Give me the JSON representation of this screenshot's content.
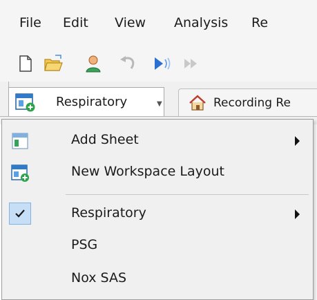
{
  "menubar": {
    "items": [
      "File",
      "Edit",
      "View",
      "Analysis",
      "Re"
    ]
  },
  "toolbar": {
    "icons": [
      "new-document-icon",
      "open-folder-icon",
      "user-icon",
      "undo-icon",
      "play-icon",
      "fast-forward-icon"
    ]
  },
  "tabs": {
    "workspace_label": "Respiratory",
    "recording_label": "Recording Re"
  },
  "menu": {
    "items": [
      {
        "label": "Add Sheet",
        "icon": "sheet-icon",
        "submenu": true
      },
      {
        "label": "New Workspace Layout",
        "icon": "new-layout-icon",
        "submenu": false
      },
      {
        "label": "Respiratory",
        "icon": "check-icon",
        "submenu": true,
        "checked": true
      },
      {
        "label": "PSG",
        "submenu": false
      },
      {
        "label": "Nox SAS",
        "submenu": false
      }
    ]
  },
  "colors": {
    "accent": "#1e8a3a",
    "check_bg": "#c6dff7",
    "menu_bg": "#f0f0f0"
  }
}
